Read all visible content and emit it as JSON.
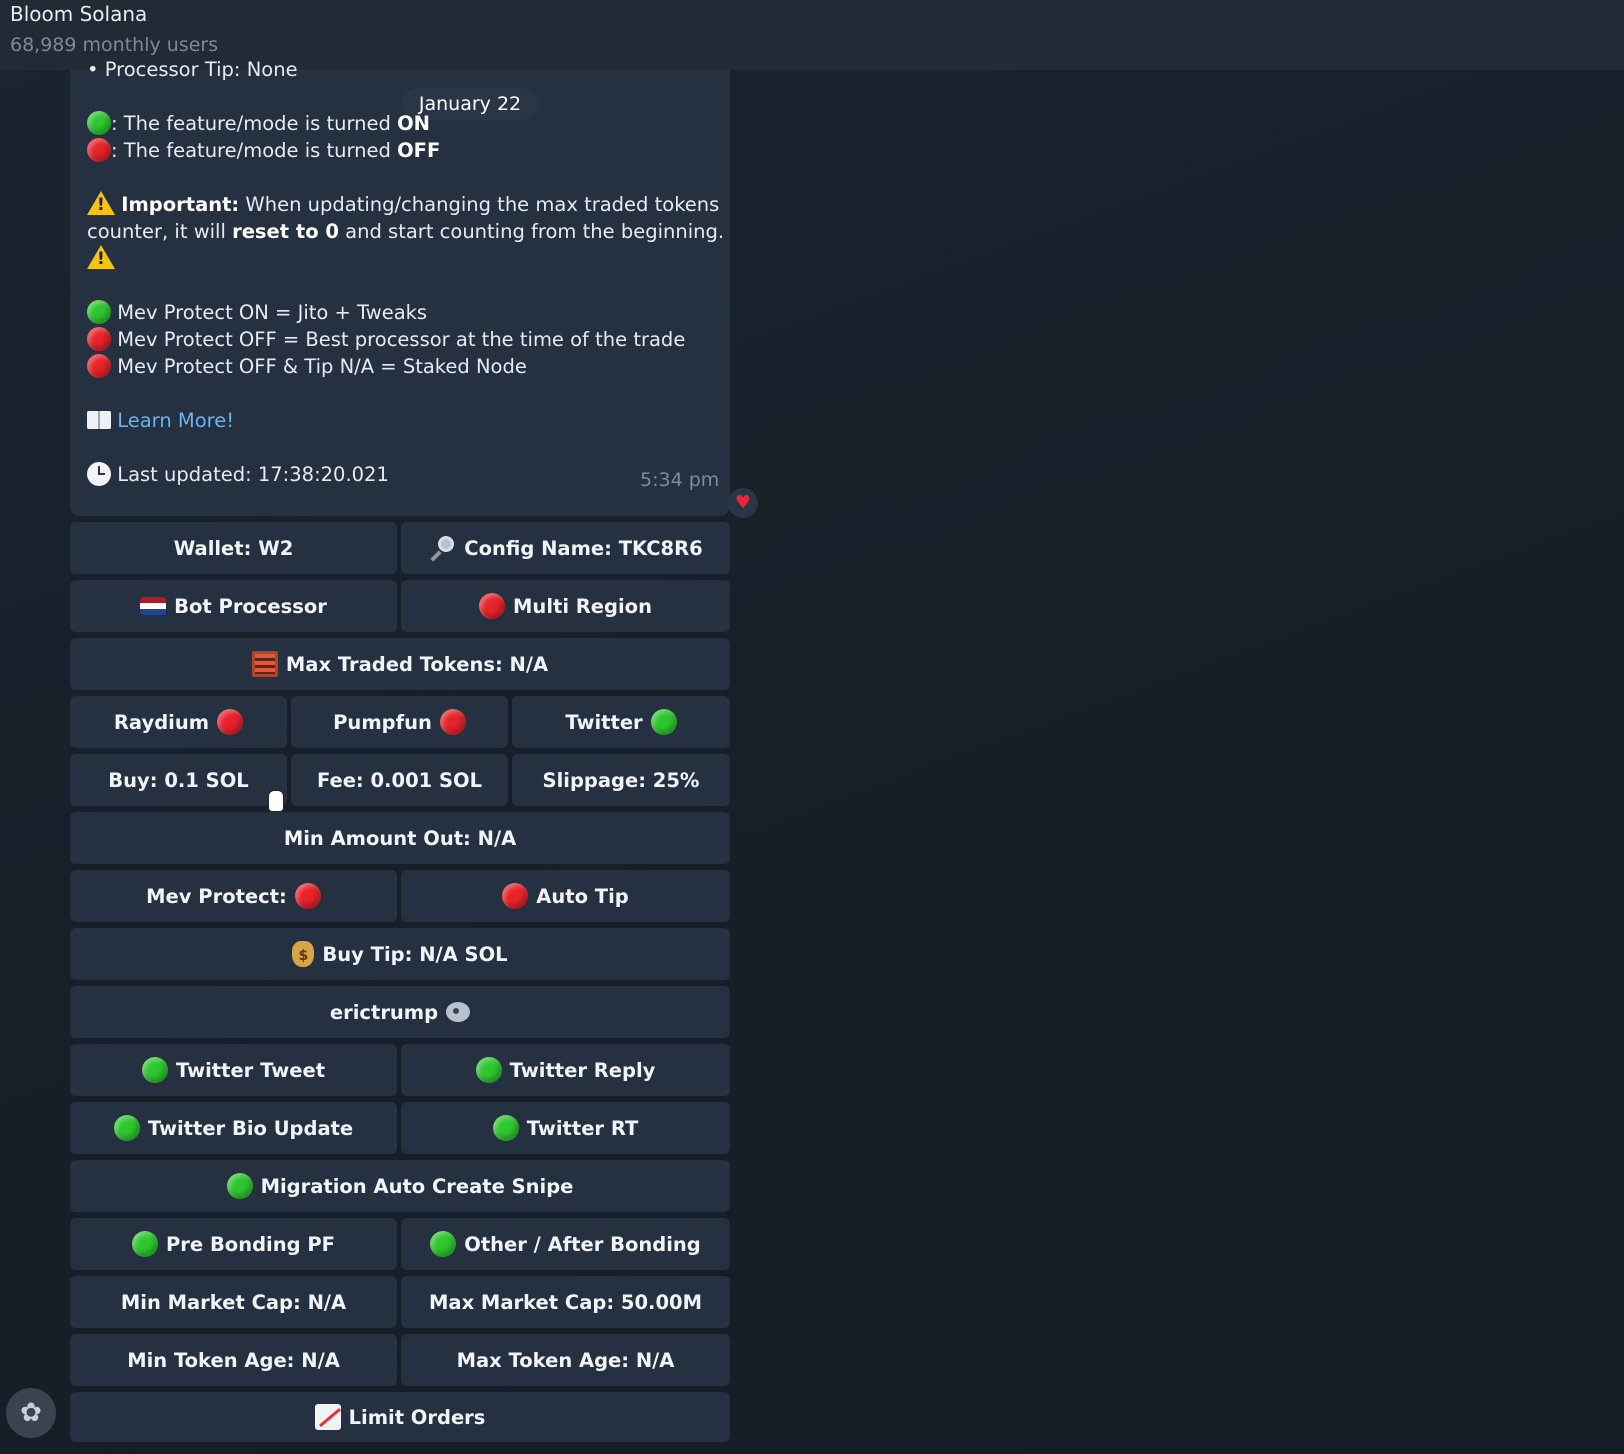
{
  "header": {
    "title": "Bloom Solana",
    "subtitle": "68,989 monthly users"
  },
  "message": {
    "top_cut_line": "• Processor Tip: None",
    "date": "January 22",
    "legend_on_prefix": ": The feature/mode is turned ",
    "legend_on_word": "ON",
    "legend_off_prefix": ": The feature/mode is turned ",
    "legend_off_word": "OFF",
    "important_label": "Important:",
    "important_text_1": " When updating/changing the max traded tokens",
    "important_text_2a": "counter, it will ",
    "important_text_2b": "reset to 0",
    "important_text_2c": " and start counting from the beginning.",
    "mev_on": "Mev Protect ON = Jito + Tweaks",
    "mev_off": "Mev Protect OFF = Best processor at the time of the trade",
    "mev_off_tip": "Mev Protect OFF & Tip N/A = Staked Node",
    "learn_more": "Learn More!",
    "last_updated": "Last updated: 17:38:20.021",
    "time": "5:34 pm"
  },
  "buttons": {
    "wallet": "Wallet: W2",
    "config_name": "Config Name: TKC8R6",
    "bot_processor": "Bot Processor",
    "multi_region": "Multi Region",
    "max_traded_tokens": "Max Traded Tokens: N/A",
    "raydium": "Raydium",
    "pumpfun": "Pumpfun",
    "twitter": "Twitter",
    "buy": "Buy: 0.1 SOL",
    "fee": "Fee: 0.001 SOL",
    "slippage": "Slippage: 25%",
    "min_amount_out": "Min Amount Out: N/A",
    "mev_protect": "Mev Protect:",
    "auto_tip": "Auto Tip",
    "buy_tip": "Buy Tip: N/A SOL",
    "username": "erictrump",
    "twitter_tweet": "Twitter Tweet",
    "twitter_reply": "Twitter Reply",
    "twitter_bio_update": "Twitter Bio Update",
    "twitter_rt": "Twitter RT",
    "migration_auto_create_snipe": "Migration Auto Create Snipe",
    "pre_bonding_pf": "Pre Bonding PF",
    "other_after_bonding": "Other / After Bonding",
    "min_market_cap": "Min Market Cap: N/A",
    "max_market_cap": "Max Market Cap: 50.00M",
    "min_token_age": "Min Token Age: N/A",
    "max_token_age": "Max Token Age: N/A",
    "limit_orders": "Limit Orders"
  },
  "status": {
    "multi_region": "off",
    "raydium": "off",
    "pumpfun": "off",
    "twitter": "on",
    "mev_protect": "off",
    "auto_tip": "off",
    "twitter_tweet": "on",
    "twitter_reply": "on",
    "twitter_bio_update": "on",
    "twitter_rt": "on",
    "migration_auto_create_snipe": "on",
    "pre_bonding_pf": "on",
    "other_after_bonding": "on"
  },
  "colors": {
    "on": "#2fc72f",
    "off": "#e8232b",
    "link": "#6ab3f3",
    "button_bg": "#253140"
  },
  "icons": {
    "config_name": "magnifier-icon",
    "bot_processor": "netherlands-flag-icon",
    "max_traded_tokens": "abacus-icon",
    "buy_tip": "money-bag-icon",
    "username": "bird-icon",
    "limit_orders": "chart-increasing-icon",
    "learn_more": "book-icon",
    "last_updated": "clock-icon",
    "important": "warning-icon",
    "reaction": "heart-icon"
  }
}
